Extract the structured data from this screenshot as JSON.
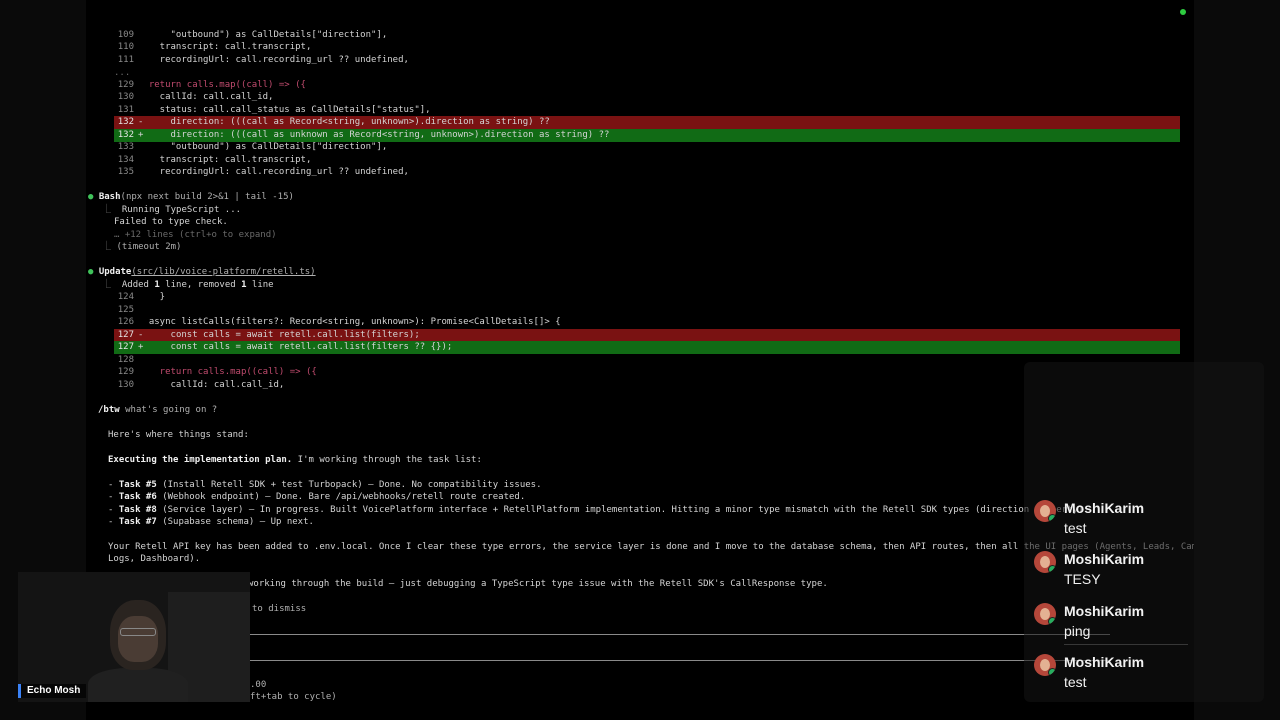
{
  "terminal": {
    "diff1": [
      {
        "n": "109",
        "text": "    \"outbound\") as CallDetails[\"direction\"],"
      },
      {
        "n": "110",
        "text": "  transcript: call.transcript,"
      },
      {
        "n": "111",
        "text": "  recordingUrl: call.recording_url ?? undefined,"
      }
    ],
    "ellipsis": "...",
    "diff2": [
      {
        "n": "129",
        "mark": "",
        "kind": "",
        "text": "return calls.map((call) => ({"
      },
      {
        "n": "130",
        "mark": "",
        "kind": "",
        "text": "  callId: call.call_id,"
      },
      {
        "n": "131",
        "mark": "",
        "kind": "",
        "text": "  status: call.call_status as CallDetails[\"status\"],"
      },
      {
        "n": "132",
        "mark": "-",
        "kind": "del",
        "text": "  direction: (((call as Record<string, unknown>).direction as string) ??"
      },
      {
        "n": "132",
        "mark": "+",
        "kind": "add",
        "text": "  direction: (((call as unknown as Record<string, unknown>).direction as string) ??"
      },
      {
        "n": "133",
        "mark": "",
        "kind": "",
        "text": "    \"outbound\") as CallDetails[\"direction\"],"
      },
      {
        "n": "134",
        "mark": "",
        "kind": "",
        "text": "  transcript: call.transcript,"
      },
      {
        "n": "135",
        "mark": "",
        "kind": "",
        "text": "  recordingUrl: call.recording_url ?? undefined,"
      }
    ],
    "bash_label": "Bash",
    "bash_cmd": "(npx next build 2>&1 | tail -15)",
    "bash_out1": "Running TypeScript ...",
    "bash_out2": "Failed to type check.",
    "bash_out3": "… +12 lines (ctrl+o to expand)",
    "bash_out4": "(timeout 2m)",
    "update_label": "Update",
    "update_path": "(src/lib/voice-platform/retell.ts)",
    "update_summary_pre": "Added ",
    "update_summary_n1": "1",
    "update_summary_mid": " line, removed ",
    "update_summary_n2": "1",
    "update_summary_post": " line",
    "diff3": [
      {
        "n": "124",
        "mark": "",
        "kind": "",
        "text": "  }"
      },
      {
        "n": "125",
        "mark": "",
        "kind": "",
        "text": ""
      },
      {
        "n": "126",
        "mark": "",
        "kind": "",
        "text": "async listCalls(filters?: Record<string, unknown>): Promise<CallDetails[]> {"
      },
      {
        "n": "127",
        "mark": "-",
        "kind": "del",
        "text": "  const calls = await retell.call.list(filters);"
      },
      {
        "n": "127",
        "mark": "+",
        "kind": "add",
        "text": "  const calls = await retell.call.list(filters ?? {});"
      },
      {
        "n": "128",
        "mark": "",
        "kind": "",
        "text": ""
      },
      {
        "n": "129",
        "mark": "",
        "kind": "",
        "text": "  return calls.map((call) => ({"
      },
      {
        "n": "130",
        "mark": "",
        "kind": "",
        "text": "    callId: call.call_id,"
      }
    ],
    "btw_cmd": "/btw",
    "btw_text": " what's going on ?",
    "intro": "Here's where things stand:",
    "plan_bold": "Executing the implementation plan.",
    "plan_rest": " I'm working through the task list:",
    "tasks": [
      {
        "label": "Task #5",
        "text": " (Install Retell SDK + test Turbopack) — Done. No compatibility issues."
      },
      {
        "label": "Task #6",
        "text": " (Webhook endpoint) — Done. Bare /api/webhooks/retell route created."
      },
      {
        "label": "Task #8",
        "text": " (Service layer) — In progress. Built VoicePlatform interface + RetellPlatform implementation. Hitting a minor type mismatch with the Retell SDK types (direction property)."
      },
      {
        "label": "Task #7",
        "text": " (Supabase schema) — Up next."
      }
    ],
    "key_line1": "Your Retell API key has been added to .env.local. Once I clear these type errors, the service layer is done and I move to the database schema, then API routes, then all the UI pages (Agents, Leads, Campaigns,",
    "key_line2": "Logs, Dashboard).",
    "summary_line": "working through the build — just debugging a TypeScript type issue with the Retell SDK's CallResponse type.",
    "dismiss_hint": "to dismiss",
    "bottom1": ".00",
    "bottom2": "ft+tab to cycle)"
  },
  "chat": {
    "messages": [
      {
        "author": "MoshiKarim",
        "text": "test"
      },
      {
        "author": "MoshiKarim",
        "text": "TESY"
      },
      {
        "author": "MoshiKarim",
        "text": "ping"
      },
      {
        "author": "MoshiKarim",
        "text": "test"
      }
    ]
  },
  "webcam": {
    "name": "Echo Mosh"
  },
  "colors": {
    "deleted_bg": "#7a1212",
    "added_bg": "#116b15",
    "status": "#2ecc40",
    "tool_bullet": "#3fc25a"
  }
}
